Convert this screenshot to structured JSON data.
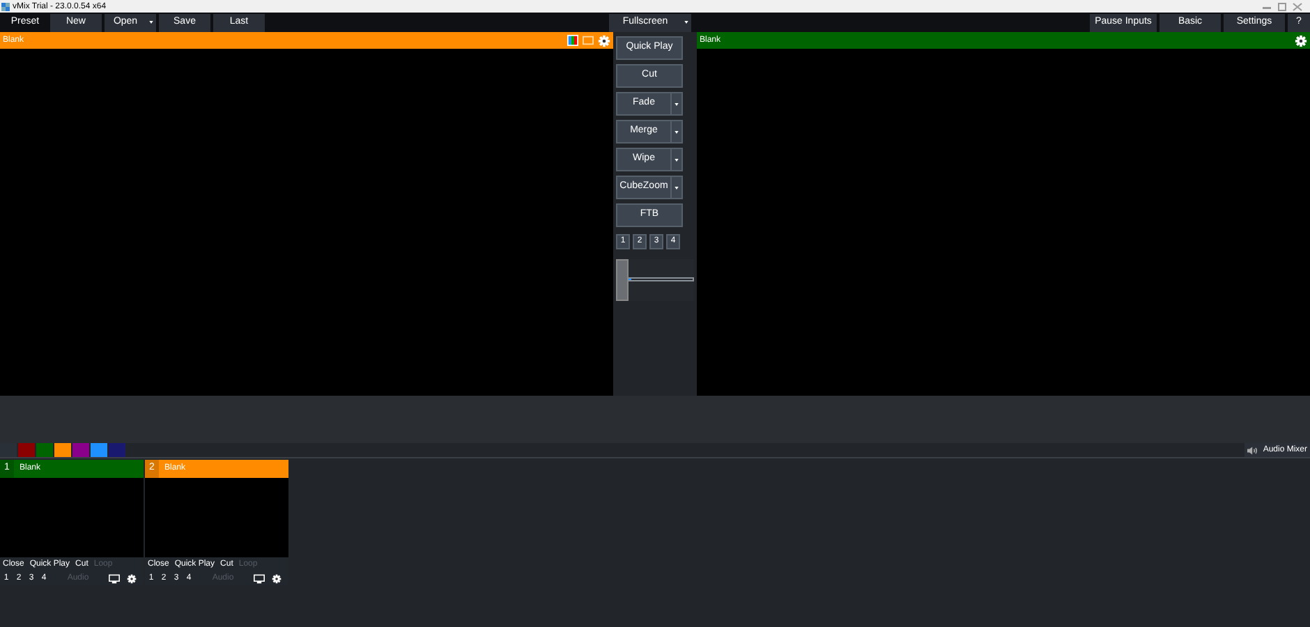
{
  "window": {
    "title": "vMix Trial - 23.0.0.54 x64"
  },
  "toolbar": {
    "label": "Preset",
    "buttons": [
      {
        "label": "New",
        "dropdown": false
      },
      {
        "label": "Open",
        "dropdown": true
      },
      {
        "label": "Save",
        "dropdown": false
      },
      {
        "label": "Last",
        "dropdown": false
      }
    ],
    "fullscreen": "Fullscreen",
    "right_buttons": [
      "Pause Inputs",
      "Basic",
      "Settings",
      "?"
    ]
  },
  "preview": {
    "title": "Blank",
    "color": "#ff8c00"
  },
  "output": {
    "title": "Blank",
    "color": "#006400"
  },
  "transitions": [
    {
      "label": "Quick Play",
      "dropdown": false
    },
    {
      "label": "Cut",
      "dropdown": false
    },
    {
      "label": "Fade",
      "dropdown": true
    },
    {
      "label": "Merge",
      "dropdown": true
    },
    {
      "label": "Wipe",
      "dropdown": true
    },
    {
      "label": "CubeZoom",
      "dropdown": true
    },
    {
      "label": "FTB",
      "dropdown": false
    }
  ],
  "transition_numbers": [
    "1",
    "2",
    "3",
    "4"
  ],
  "t_bar": {
    "level": 0
  },
  "color_filters": [
    {
      "color": "#2a3038"
    },
    {
      "color": "#8b0000"
    },
    {
      "color": "#006400"
    },
    {
      "color": "#ff8c00"
    },
    {
      "color": "#8b008b"
    },
    {
      "color": "#1e90ff"
    },
    {
      "color": "#191970"
    }
  ],
  "audio_mixer": "Audio Mixer",
  "inputs": [
    {
      "number": "1",
      "title": "Blank",
      "color": "#006400",
      "buttons": [
        {
          "label": "Close",
          "disabled": false
        },
        {
          "label": "Quick Play",
          "disabled": false
        },
        {
          "label": "Cut",
          "disabled": false
        },
        {
          "label": "Loop",
          "disabled": true
        }
      ],
      "numbers": [
        "1",
        "2",
        "3",
        "4"
      ],
      "audio": {
        "label": "Audio",
        "disabled": true
      }
    },
    {
      "number": "2",
      "title": "Blank",
      "color": "#ff8c00",
      "buttons": [
        {
          "label": "Close",
          "disabled": false
        },
        {
          "label": "Quick Play",
          "disabled": false
        },
        {
          "label": "Cut",
          "disabled": false
        },
        {
          "label": "Loop",
          "disabled": true
        }
      ],
      "numbers": [
        "1",
        "2",
        "3",
        "4"
      ],
      "audio": {
        "label": "Audio",
        "disabled": true
      }
    }
  ]
}
